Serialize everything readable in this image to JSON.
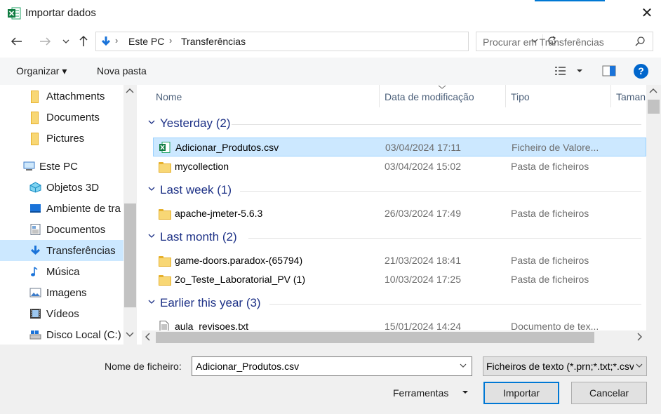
{
  "window": {
    "title": "Importar dados",
    "close_glyph": "✕"
  },
  "address": {
    "segments": [
      "Este PC",
      "Transferências"
    ]
  },
  "search": {
    "placeholder": "Procurar em Transferências"
  },
  "toolbar": {
    "organize": "Organizar ▾",
    "new_folder": "Nova pasta",
    "help": "?"
  },
  "nav": {
    "items": [
      {
        "label": "Attachments",
        "icon": "folder-icon"
      },
      {
        "label": "Documents",
        "icon": "folder-icon"
      },
      {
        "label": "Pictures",
        "icon": "folder-icon"
      },
      {
        "label": "Este PC",
        "icon": "computer-icon"
      },
      {
        "label": "Objetos 3D",
        "icon": "cube-icon"
      },
      {
        "label": "Ambiente de tra",
        "icon": "desktop-icon"
      },
      {
        "label": "Documentos",
        "icon": "document-icon"
      },
      {
        "label": "Transferências",
        "icon": "download-icon",
        "selected": true
      },
      {
        "label": "Música",
        "icon": "music-icon"
      },
      {
        "label": "Imagens",
        "icon": "image-icon"
      },
      {
        "label": "Vídeos",
        "icon": "video-icon"
      },
      {
        "label": "Disco Local (C:)",
        "icon": "drive-icon"
      }
    ]
  },
  "columns": {
    "name": "Nome",
    "date": "Data de modificação",
    "type": "Tipo",
    "size": "Taman"
  },
  "groups": [
    {
      "title": "Yesterday (2)",
      "files": [
        {
          "name": "Adicionar_Produtos.csv",
          "date": "03/04/2024 17:11",
          "type": "Ficheiro de Valore...",
          "icon": "excel-csv-icon",
          "selected": true
        },
        {
          "name": "mycollection",
          "date": "03/04/2024 15:02",
          "type": "Pasta de ficheiros",
          "icon": "folder-icon"
        }
      ]
    },
    {
      "title": "Last week (1)",
      "files": [
        {
          "name": "apache-jmeter-5.6.3",
          "date": "26/03/2024 17:49",
          "type": "Pasta de ficheiros",
          "icon": "folder-icon"
        }
      ]
    },
    {
      "title": "Last month (2)",
      "files": [
        {
          "name": "game-doors.paradox-(65794)",
          "date": "21/03/2024 18:41",
          "type": "Pasta de ficheiros",
          "icon": "folder-icon"
        },
        {
          "name": "2o_Teste_Laboratorial_PV (1)",
          "date": "10/03/2024 17:25",
          "type": "Pasta de ficheiros",
          "icon": "folder-icon"
        }
      ]
    },
    {
      "title": "Earlier this year (3)",
      "files": [
        {
          "name": "aula_revisoes.txt",
          "date": "15/01/2024 14:24",
          "type": "Documento de tex...",
          "icon": "text-file-icon"
        }
      ]
    }
  ],
  "footer": {
    "filename_label": "Nome de ficheiro:",
    "filename_value": "Adicionar_Produtos.csv",
    "filetype_value": "Ficheiros de texto (*.prn;*.txt;*.csv)",
    "tools_label": "Ferramentas",
    "import_label": "Importar",
    "cancel_label": "Cancelar"
  },
  "colors": {
    "accent": "#0078d4",
    "selection": "#cce8ff",
    "group_header": "#1e3287"
  }
}
